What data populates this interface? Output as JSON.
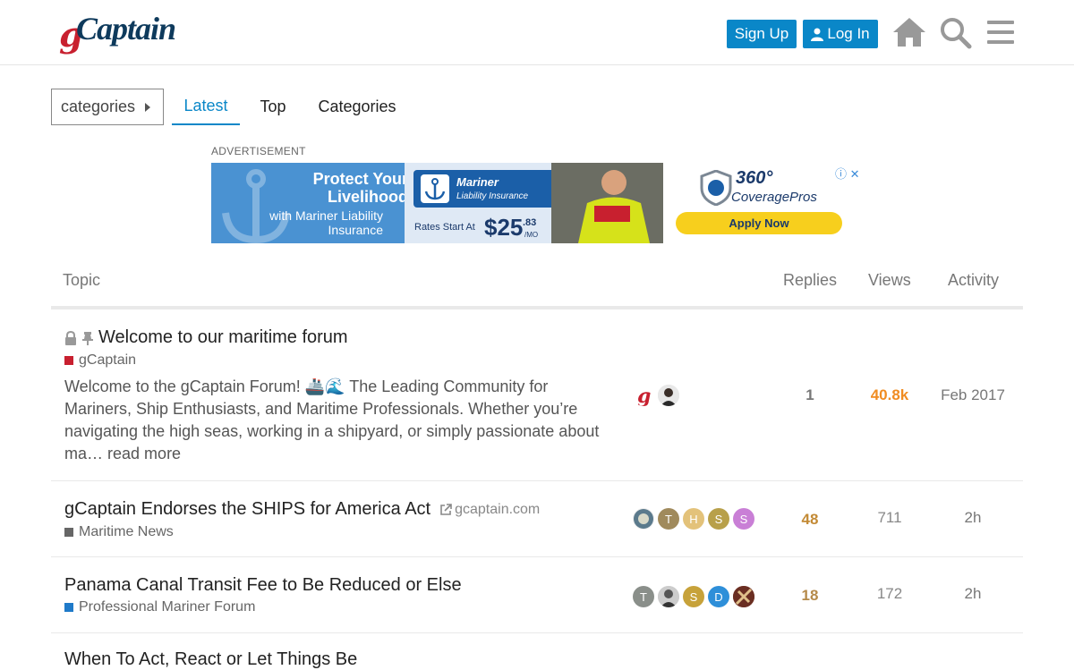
{
  "header": {
    "logo_g": "g",
    "logo_rest": "Captain",
    "signup_label": "Sign Up",
    "login_label": "Log In"
  },
  "nav": {
    "dropdown_label": "categories",
    "tabs": [
      {
        "label": "Latest",
        "active": true
      },
      {
        "label": "Top",
        "active": false
      },
      {
        "label": "Categories",
        "active": false
      }
    ]
  },
  "ad": {
    "label": "ADVERTISEMENT",
    "headline": "Protect Your Livelihood",
    "sub": "with Mariner Liability Insurance",
    "box_title": "Mariner",
    "box_sub": "Liability Insurance",
    "rates": "Rates Start At",
    "price": "$25",
    "cents": ".83",
    "per": "/MO",
    "brand_num": "360°",
    "brand_name": "CoveragePros",
    "apply": "Apply Now",
    "close": "ⓘ ✕"
  },
  "table": {
    "headers": {
      "topic": "Topic",
      "replies": "Replies",
      "views": "Views",
      "activity": "Activity"
    },
    "rows": [
      {
        "title": "Welcome to our maritime forum",
        "category": "gCaptain",
        "category_color": "#c8202f",
        "excerpt": "Welcome to the gCaptain Forum! 🚢🌊 The Leading Community for Mariners, Ship Enthusiasts, and Maritime Professionals. Whether you’re navigating the high seas, working in a shipyard, or simply passionate about ma…",
        "read_more": "read more",
        "replies": "1",
        "views": "40.8k",
        "activity": "Feb 2017"
      },
      {
        "title": "gCaptain Endorses the SHIPS for America Act",
        "link_domain": "gcaptain.com",
        "category": "Maritime News",
        "category_color": "#666666",
        "avatars": [
          "",
          "T",
          "H",
          "S",
          "S"
        ],
        "replies": "48",
        "views": "711",
        "activity": "2h"
      },
      {
        "title": "Panama Canal Transit Fee to Be Reduced or Else",
        "category": "Professional Mariner Forum",
        "category_color": "#1f7ac9",
        "avatars": [
          "T",
          "",
          "S",
          "D",
          ""
        ],
        "replies": "18",
        "views": "172",
        "activity": "2h"
      },
      {
        "title": "When To Act, React or Let Things Be"
      }
    ]
  },
  "colors": {
    "accent": "#0a87c8",
    "hot_views": "#f08c22",
    "replies_hot": "#c38a35"
  }
}
